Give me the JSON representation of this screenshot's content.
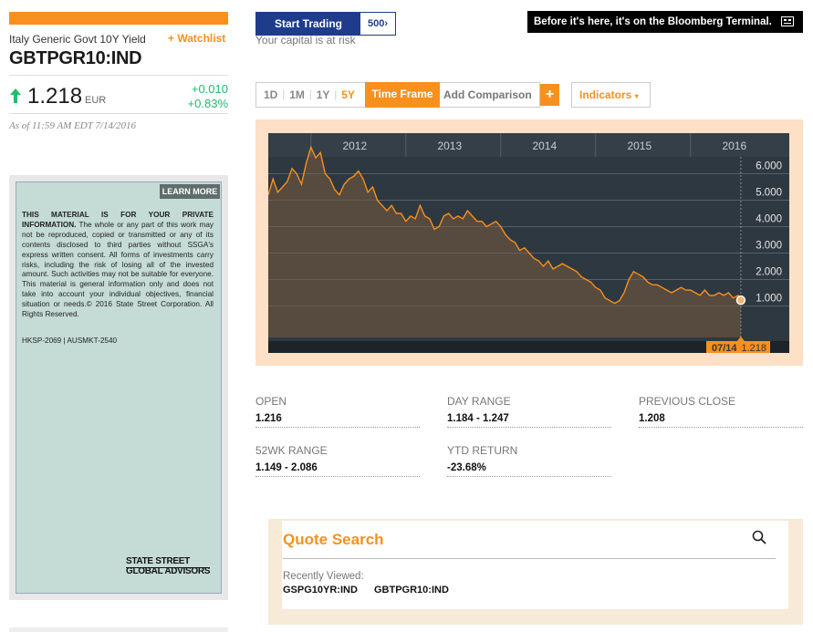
{
  "security": {
    "name": "Italy Generic Govt 10Y Yield",
    "watchlist_label": "+ Watchlist",
    "ticker": "GBTPGR10:IND",
    "price": "1.218",
    "currency": "EUR",
    "change": "+0.010",
    "change_pct": "+0.83%",
    "as_of": "As of 11:59 AM EDT 7/14/2016"
  },
  "ad": {
    "learn_more": "LEARN MORE",
    "heading": "THIS MATERIAL IS FOR YOUR PRIVATE INFORMATION.",
    "body": "The whole or any part of this work may not be reproduced, copied or transmitted or any of its contents disclosed to third parties without SSGA's express written consent. All forms of investments carry risks, including the risk of losing all of the invested amount. Such activities may not be suitable for everyone. This material is general information only and does not take into account your individual objectives, financial situation or needs.© 2016 State Street Corporation. All Rights Reserved.",
    "code": "HKSP-2069 | AUSMKT-2540",
    "brand_line1": "STATE STREET",
    "brand_line2": "GLOBAL ADVISORS"
  },
  "trading": {
    "start_label": "Start Trading",
    "brand_label": "500",
    "capital_risk": "Your capital is at risk"
  },
  "banner": {
    "text": "Before it's here, it's on the Bloomberg Terminal."
  },
  "toolbar": {
    "ranges": [
      "1D",
      "1M",
      "1Y",
      "5Y"
    ],
    "active_range": "5Y",
    "time_frame": "Time Frame",
    "add_comparison": "Add Comparison",
    "plus": "+",
    "indicators": "Indicators"
  },
  "chart_data": {
    "type": "area",
    "x_labels": [
      "2012",
      "2013",
      "2014",
      "2015",
      "2016"
    ],
    "y_ticks": [
      "6.000",
      "5.000",
      "4.000",
      "3.000",
      "2.000",
      "1.000"
    ],
    "ylim": [
      0.5,
      6.5
    ],
    "current_label_date": "07/14",
    "current_label_value": "1.218",
    "line_color": "#f7901e",
    "background": "#2e3840",
    "x": [
      2011.55,
      2011.6,
      2011.65,
      2011.7,
      2011.75,
      2011.8,
      2011.85,
      2011.9,
      2011.95,
      2012.0,
      2012.05,
      2012.1,
      2012.15,
      2012.2,
      2012.25,
      2012.3,
      2012.35,
      2012.4,
      2012.45,
      2012.5,
      2012.55,
      2012.6,
      2012.65,
      2012.7,
      2012.75,
      2012.8,
      2012.85,
      2012.9,
      2012.95,
      2013.0,
      2013.05,
      2013.1,
      2013.15,
      2013.2,
      2013.25,
      2013.3,
      2013.35,
      2013.4,
      2013.45,
      2013.5,
      2013.55,
      2013.6,
      2013.65,
      2013.7,
      2013.75,
      2013.8,
      2013.85,
      2013.9,
      2013.95,
      2014.0,
      2014.05,
      2014.1,
      2014.15,
      2014.2,
      2014.25,
      2014.3,
      2014.35,
      2014.4,
      2014.45,
      2014.5,
      2014.55,
      2014.6,
      2014.65,
      2014.7,
      2014.75,
      2014.8,
      2014.85,
      2014.9,
      2014.95,
      2015.0,
      2015.05,
      2015.1,
      2015.15,
      2015.2,
      2015.25,
      2015.3,
      2015.35,
      2015.4,
      2015.45,
      2015.5,
      2015.55,
      2015.6,
      2015.65,
      2015.7,
      2015.75,
      2015.8,
      2015.85,
      2015.9,
      2015.95,
      2016.0,
      2016.05,
      2016.1,
      2016.15,
      2016.2,
      2016.25,
      2016.3,
      2016.35,
      2016.4,
      2016.45,
      2016.5,
      2016.53
    ],
    "y": [
      5.2,
      5.8,
      5.3,
      5.5,
      5.7,
      6.2,
      6.0,
      5.6,
      6.4,
      7.0,
      6.6,
      6.8,
      6.0,
      5.8,
      5.4,
      5.2,
      5.6,
      5.8,
      5.9,
      6.1,
      5.8,
      5.3,
      5.5,
      5.0,
      4.8,
      4.6,
      4.8,
      4.5,
      4.5,
      4.2,
      4.4,
      4.3,
      4.8,
      4.4,
      4.3,
      3.9,
      4.0,
      4.4,
      4.5,
      4.3,
      4.4,
      4.3,
      4.6,
      4.4,
      4.2,
      4.2,
      4.0,
      4.1,
      4.2,
      4.0,
      3.7,
      3.5,
      3.4,
      3.1,
      3.2,
      3.0,
      2.8,
      2.7,
      2.5,
      2.7,
      2.4,
      2.5,
      2.6,
      2.5,
      2.4,
      2.3,
      2.1,
      2.0,
      1.9,
      1.7,
      1.6,
      1.3,
      1.2,
      1.1,
      1.2,
      1.5,
      2.0,
      2.3,
      2.2,
      2.1,
      1.9,
      1.8,
      1.8,
      1.7,
      1.6,
      1.5,
      1.6,
      1.7,
      1.6,
      1.6,
      1.5,
      1.4,
      1.6,
      1.4,
      1.4,
      1.5,
      1.4,
      1.5,
      1.3,
      1.4,
      1.218
    ]
  },
  "stats": [
    {
      "label": "OPEN",
      "value": "1.216"
    },
    {
      "label": "DAY RANGE",
      "value": "1.184 - 1.247"
    },
    {
      "label": "PREVIOUS CLOSE",
      "value": "1.208"
    },
    {
      "label": "52WK RANGE",
      "value": "1.149 - 2.086"
    },
    {
      "label": "YTD RETURN",
      "value": "-23.68%"
    }
  ],
  "quote_search": {
    "title": "Quote Search",
    "recent_label": "Recently Viewed:",
    "recent": [
      "GSPG10YR:IND",
      "GBTPGR10:IND"
    ]
  },
  "colors": {
    "accent": "#f7901e",
    "positive": "#1ebd6f",
    "brand_blue": "#1f3c8c"
  }
}
